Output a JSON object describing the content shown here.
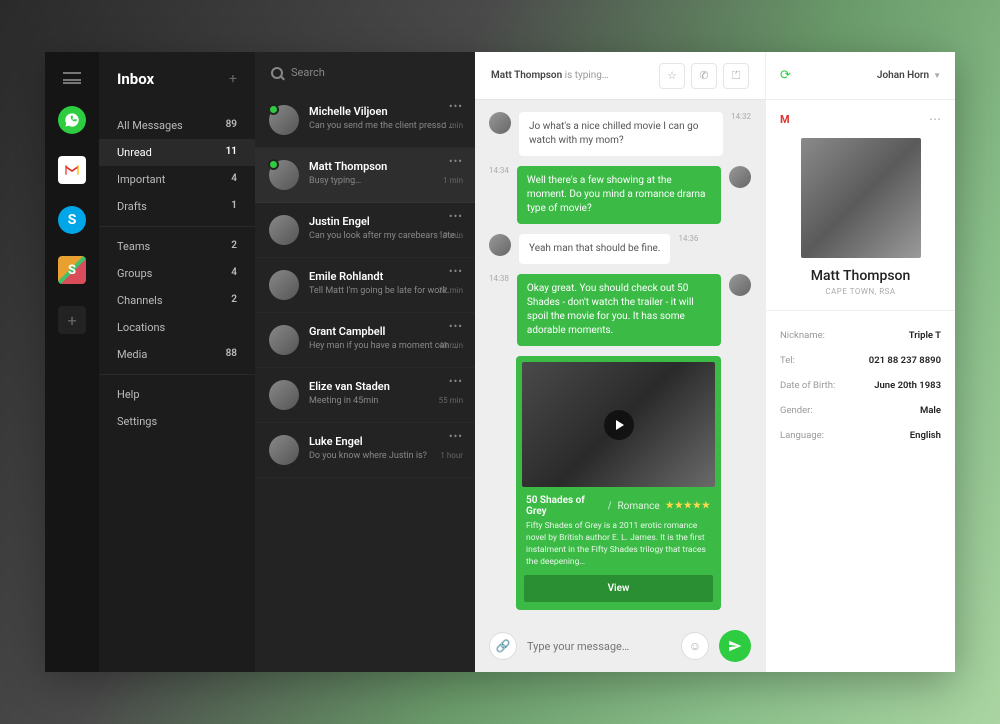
{
  "nav": {
    "title": "Inbox",
    "groups": [
      [
        {
          "label": "All Messages",
          "count": "89"
        },
        {
          "label": "Unread",
          "count": "11",
          "active": true
        },
        {
          "label": "Important",
          "count": "4"
        },
        {
          "label": "Drafts",
          "count": "1"
        }
      ],
      [
        {
          "label": "Teams",
          "count": "2"
        },
        {
          "label": "Groups",
          "count": "4"
        },
        {
          "label": "Channels",
          "count": "2"
        },
        {
          "label": "Locations",
          "count": ""
        },
        {
          "label": "Media",
          "count": "88"
        }
      ],
      [
        {
          "label": "Help",
          "count": ""
        },
        {
          "label": "Settings",
          "count": ""
        }
      ]
    ]
  },
  "search": {
    "placeholder": "Search"
  },
  "threads": [
    {
      "name": "Michelle Viljoen",
      "preview": "Can you send me the client presso …",
      "time": "1 min",
      "online": true
    },
    {
      "name": "Matt Thompson",
      "preview": "Busy typing…",
      "time": "1 min",
      "online": true,
      "selected": true
    },
    {
      "name": "Justin Engel",
      "preview": "Can you look after my carebears later?",
      "time": "10 min"
    },
    {
      "name": "Emile Rohlandt",
      "preview": "Tell Matt I'm going be late for work.",
      "time": "32 min"
    },
    {
      "name": "Grant Campbell",
      "preview": "Hey man if you have a moment can you…",
      "time": "40 min"
    },
    {
      "name": "Elize van Staden",
      "preview": "Meeting in 45min",
      "time": "55 min"
    },
    {
      "name": "Luke Engel",
      "preview": "Do you know where Justin is?",
      "time": "1 hour"
    }
  ],
  "chat": {
    "typing_name": "Matt Thompson",
    "typing_suffix": " is typing…",
    "messages": [
      {
        "side": "in",
        "time": "14:32",
        "text": "Jo what's a nice chilled movie I can go watch with my mom?"
      },
      {
        "side": "out",
        "time": "14:34",
        "text": "Well there's a few showing at the moment. Do you mind a romance drama type of movie?"
      },
      {
        "side": "in",
        "time": "14:36",
        "text": "Yeah man that should be fine."
      },
      {
        "side": "out",
        "time": "14:38",
        "text": "Okay great. You should check out 50 Shades - don't watch the trailer - it will spoil the movie for you. It has some adorable moments."
      }
    ],
    "card": {
      "title": "50 Shades of Grey",
      "genre": "Romance",
      "stars": "★★★★★",
      "desc": "Fifty Shades of Grey is a 2011 erotic romance novel by British author E. L. James. It is the first instalment in the Fifty Shades trilogy that traces the deepening…",
      "button": "View"
    },
    "compose_placeholder": "Type your message…"
  },
  "header": {
    "user": "Johan Horn"
  },
  "profile": {
    "name": "Matt Thompson",
    "location": "Cape Town, RSA",
    "fields": [
      {
        "k": "Nickname:",
        "v": "Triple T"
      },
      {
        "k": "Tel:",
        "v": "021 88 237 8890"
      },
      {
        "k": "Date of Birth:",
        "v": "June 20th 1983"
      },
      {
        "k": "Gender:",
        "v": "Male"
      },
      {
        "k": "Language:",
        "v": "English"
      }
    ]
  }
}
